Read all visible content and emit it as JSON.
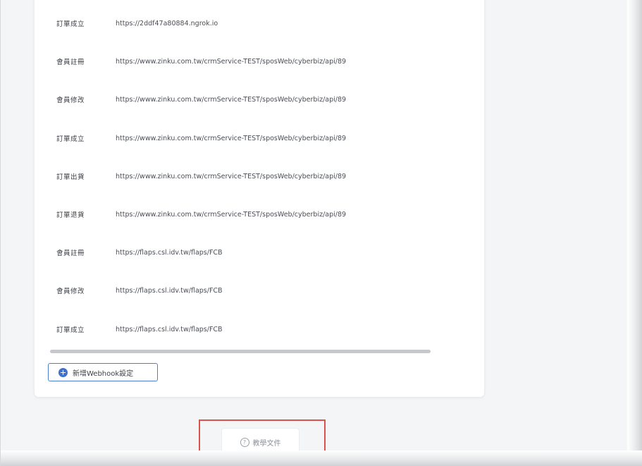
{
  "webhooks": [
    {
      "event": "訂單成立",
      "url": "https://2ddf47a80884.ngrok.io"
    },
    {
      "event": "會員註冊",
      "url": "https://www.zinku.com.tw/crmService-TEST/sposWeb/cyberbiz/api/89"
    },
    {
      "event": "會員修改",
      "url": "https://www.zinku.com.tw/crmService-TEST/sposWeb/cyberbiz/api/89"
    },
    {
      "event": "訂單成立",
      "url": "https://www.zinku.com.tw/crmService-TEST/sposWeb/cyberbiz/api/89"
    },
    {
      "event": "訂單出貨",
      "url": "https://www.zinku.com.tw/crmService-TEST/sposWeb/cyberbiz/api/89"
    },
    {
      "event": "訂單退貨",
      "url": "https://www.zinku.com.tw/crmService-TEST/sposWeb/cyberbiz/api/89"
    },
    {
      "event": "會員註冊",
      "url": "https://flaps.csl.idv.tw/flaps/FCB"
    },
    {
      "event": "會員修改",
      "url": "https://flaps.csl.idv.tw/flaps/FCB"
    },
    {
      "event": "訂單成立",
      "url": "https://flaps.csl.idv.tw/flaps/FCB"
    }
  ],
  "add_button": {
    "label": "新增Webhook設定",
    "icon": "plus-circle-icon",
    "color": "#3f6fcf"
  },
  "doc_button": {
    "label": "教學文件",
    "icon": "question-circle-icon",
    "icon_glyph": "?"
  },
  "highlight_color": "#d9534f"
}
